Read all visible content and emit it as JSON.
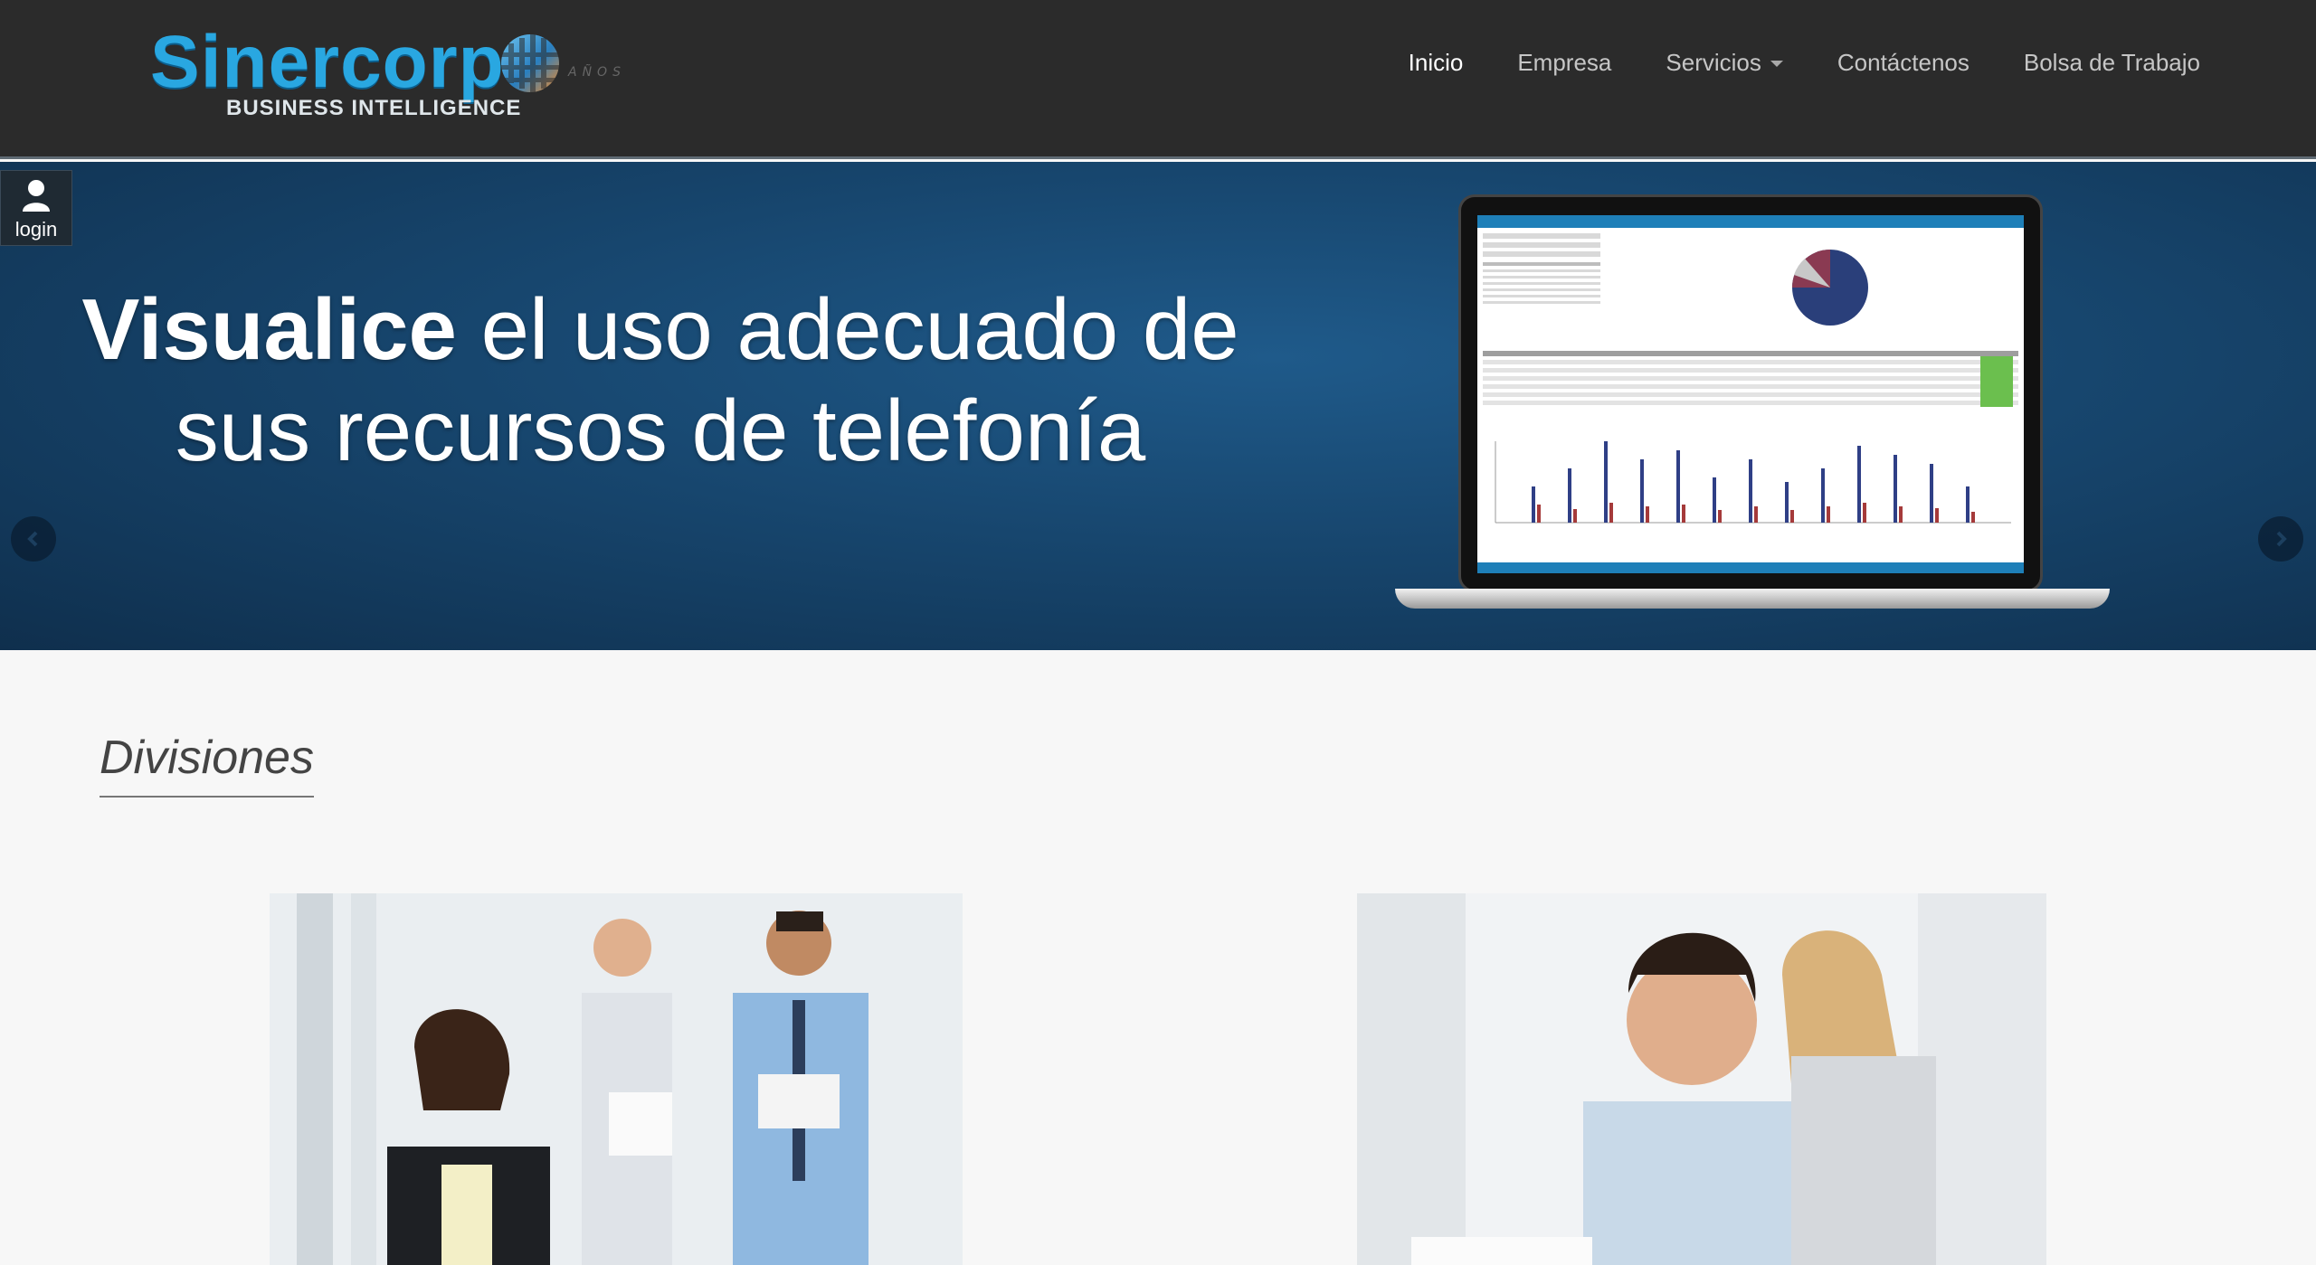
{
  "brand": {
    "wordmark": "Sinercorp",
    "tagline": "BUSINESS INTELLIGENCE",
    "badge": "AÑOS",
    "primary_color": "#29a7e1"
  },
  "nav": {
    "items": [
      {
        "label": "Inicio",
        "active": true
      },
      {
        "label": "Empresa",
        "active": false
      },
      {
        "label": "Servicios",
        "active": false,
        "has_dropdown": true
      },
      {
        "label": "Contáctenos",
        "active": false
      },
      {
        "label": "Bolsa de Trabajo",
        "active": false
      }
    ]
  },
  "hero": {
    "title_bold": "Visualice",
    "title_rest": " el uso adecuado de sus recursos de telefonía",
    "login_label": "login",
    "background": "#17466e"
  },
  "section": {
    "title": "Divisiones"
  },
  "icons": {
    "login": "user-icon",
    "prev": "chevron-left-icon",
    "next": "chevron-right-icon"
  }
}
